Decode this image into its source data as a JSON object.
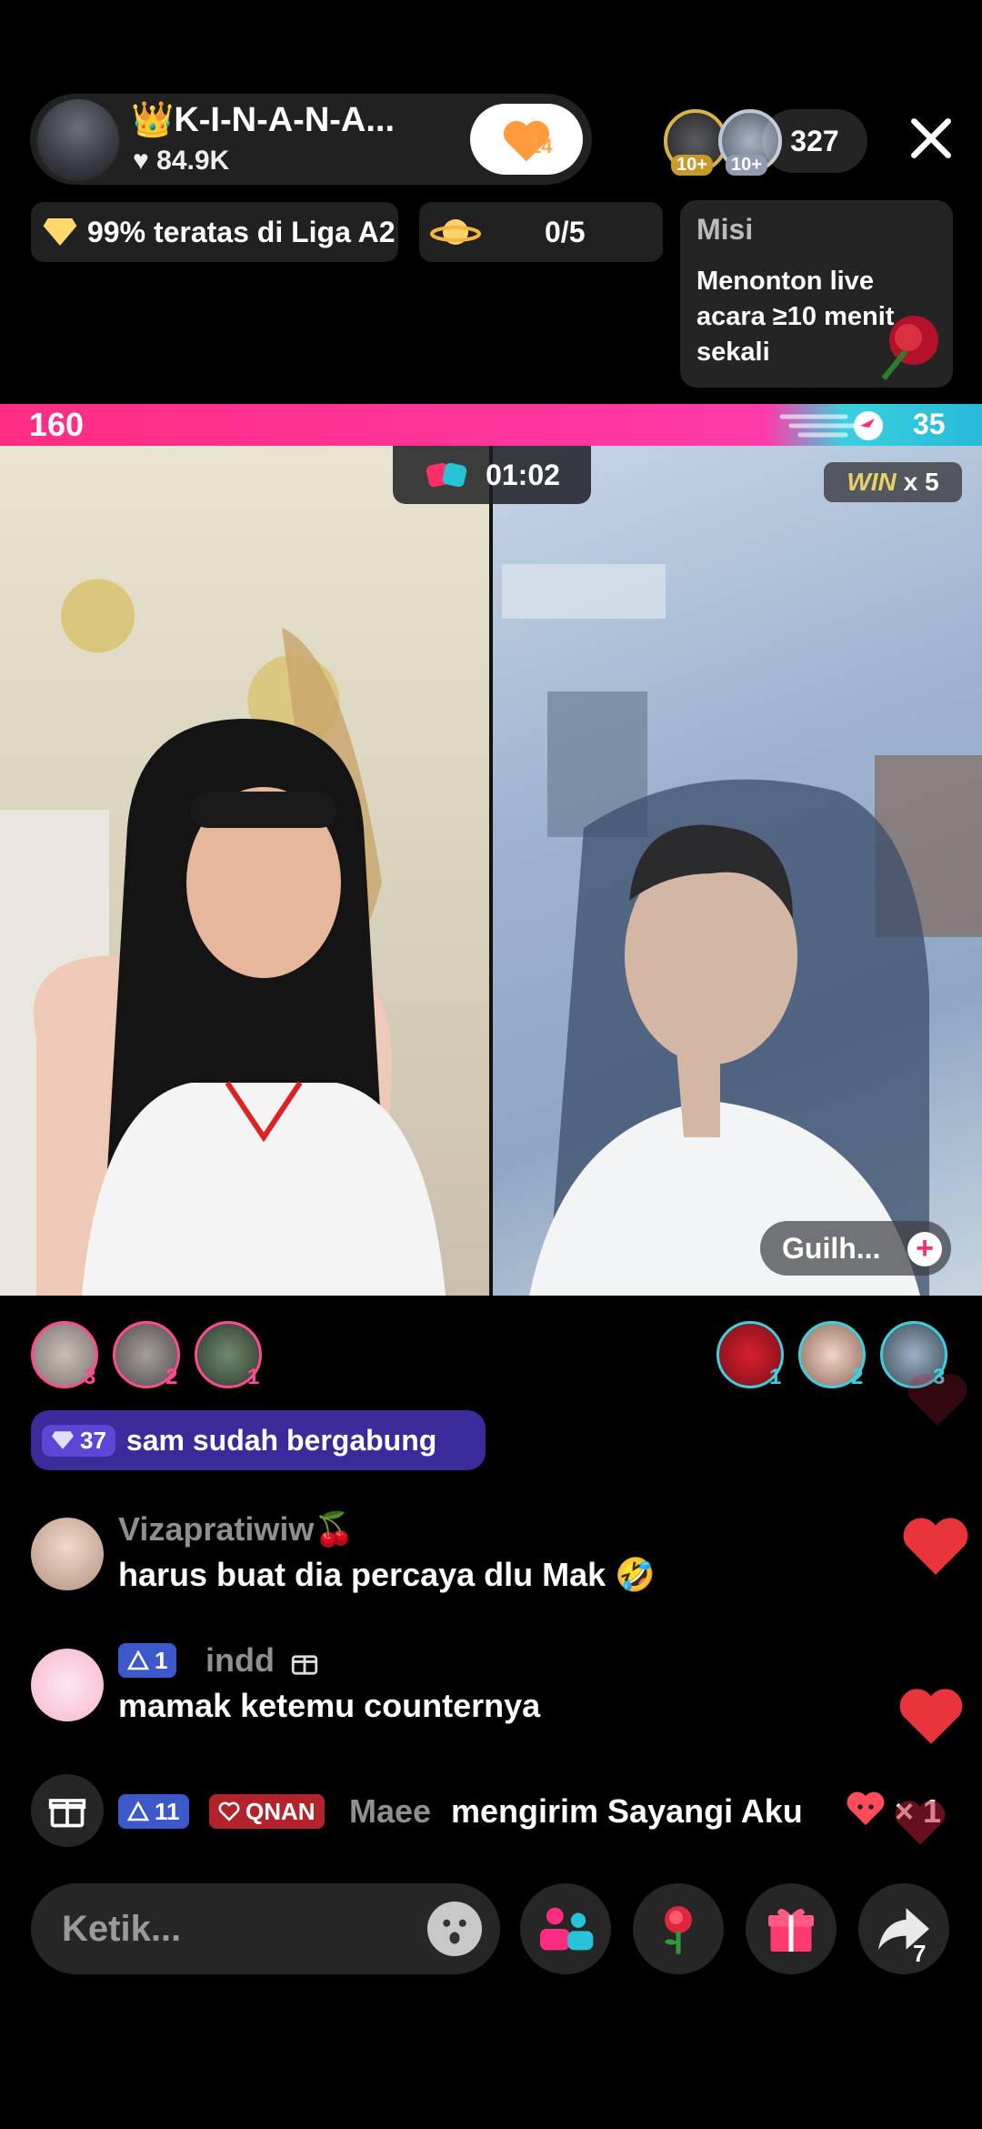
{
  "host": {
    "name": "👑K-I-N-A-N-A...",
    "likes": "84.9K",
    "follow_count": "14"
  },
  "viewers": {
    "badges": [
      "10+",
      "10+"
    ],
    "count": "327"
  },
  "chips": {
    "league": "99% teratas di Liga A2",
    "progress": "0/5"
  },
  "mission": {
    "title": "Misi",
    "text": "Menonton live acara ≥10 menit sekali"
  },
  "battle": {
    "score_left": "160",
    "score_right": "35",
    "timer": "01:02",
    "win_label": "WIN",
    "win_mult": "x 5",
    "guest_name": "Guilh..."
  },
  "supporters": {
    "left_ranks": [
      "3",
      "2",
      "1"
    ],
    "right_ranks": [
      "1",
      "2",
      "3"
    ]
  },
  "join": {
    "level": "37",
    "text": "sam sudah bergabung"
  },
  "comments": [
    {
      "name": "Vizapratiwiw🍒",
      "text": "harus buat dia percaya dlu Mak 🤣"
    },
    {
      "level": "1",
      "name": "indd",
      "text": "mamak ketemu counternya"
    }
  ],
  "gift_msg": {
    "level": "11",
    "club": "QNAN",
    "name": "Maee",
    "text": "mengirim Sayangi Aku",
    "count": "× 1"
  },
  "bottom": {
    "placeholder": "Ketik...",
    "share_count": "7"
  },
  "colors": {
    "accent_pink": "#ff2d82",
    "accent_cyan": "#3bd0e0",
    "join_banner": "#3a2a9a",
    "heart_red": "#e8343a"
  }
}
